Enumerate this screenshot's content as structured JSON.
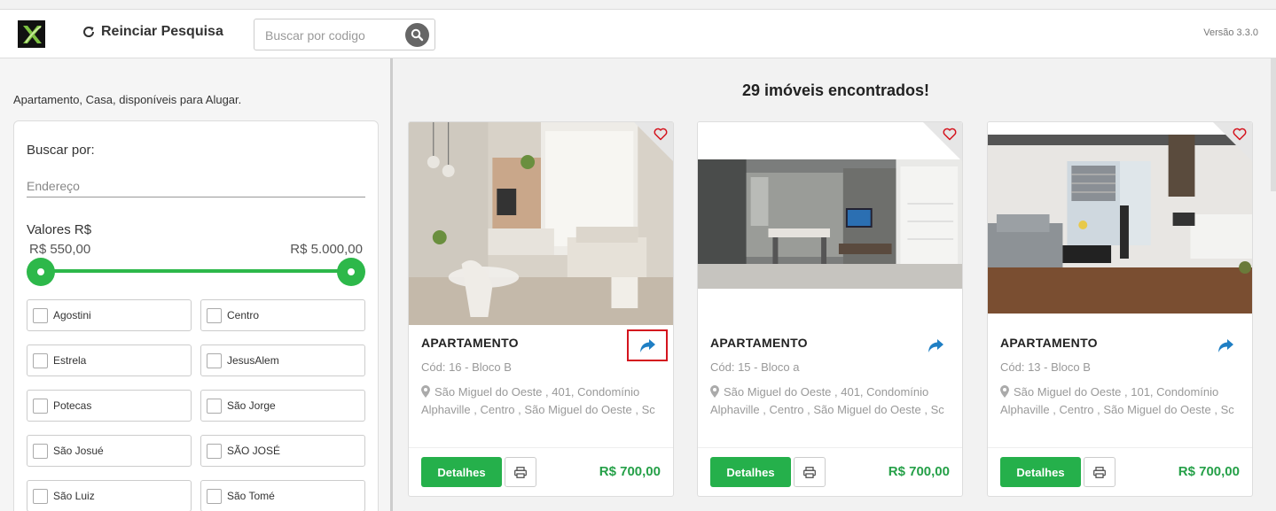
{
  "header": {
    "reset_label": "Reinciar Pesquisa",
    "search_placeholder": "Buscar por codigo",
    "version": "Versão 3.3.0"
  },
  "filters": {
    "description": "Apartamento, Casa, disponíveis para Alugar.",
    "buscar_label": "Buscar por:",
    "address_placeholder": "Endereço",
    "valores_label": "Valores R$",
    "price_min": "R$ 550,00",
    "price_max": "R$ 5.000,00",
    "neighborhoods": [
      "Agostini",
      "Centro",
      "Estrela",
      "JesusAlem",
      "Potecas",
      "São Jorge",
      "São Josué",
      "SÃO JOSÉ",
      "São Luiz",
      "São Tomé"
    ]
  },
  "results": {
    "title": "29 imóveis encontrados!"
  },
  "cards": [
    {
      "type": "APARTAMENTO",
      "code": "Cód: 16 - Bloco B",
      "address": "São Miguel do Oeste , 401, Condomínio Alphaville , Centro , São Miguel do Oeste , Sc",
      "details_label": "Detalhes",
      "price": "R$ 700,00"
    },
    {
      "type": "APARTAMENTO",
      "code": "Cód: 15 - Bloco a",
      "address": "São Miguel do Oeste , 401, Condomínio Alphaville , Centro , São Miguel do Oeste , Sc",
      "details_label": "Detalhes",
      "price": "R$ 700,00"
    },
    {
      "type": "APARTAMENTO",
      "code": "Cód: 13 - Bloco B",
      "address": "São Miguel do Oeste , 101, Condomínio Alphaville , Centro , São Miguel do Oeste , Sc",
      "details_label": "Detalhes",
      "price": "R$ 700,00"
    }
  ],
  "colors": {
    "accent_green": "#25b04b",
    "price_green": "#25a048",
    "share_blue": "#1f7fc4",
    "heart_red": "#d4141e"
  }
}
